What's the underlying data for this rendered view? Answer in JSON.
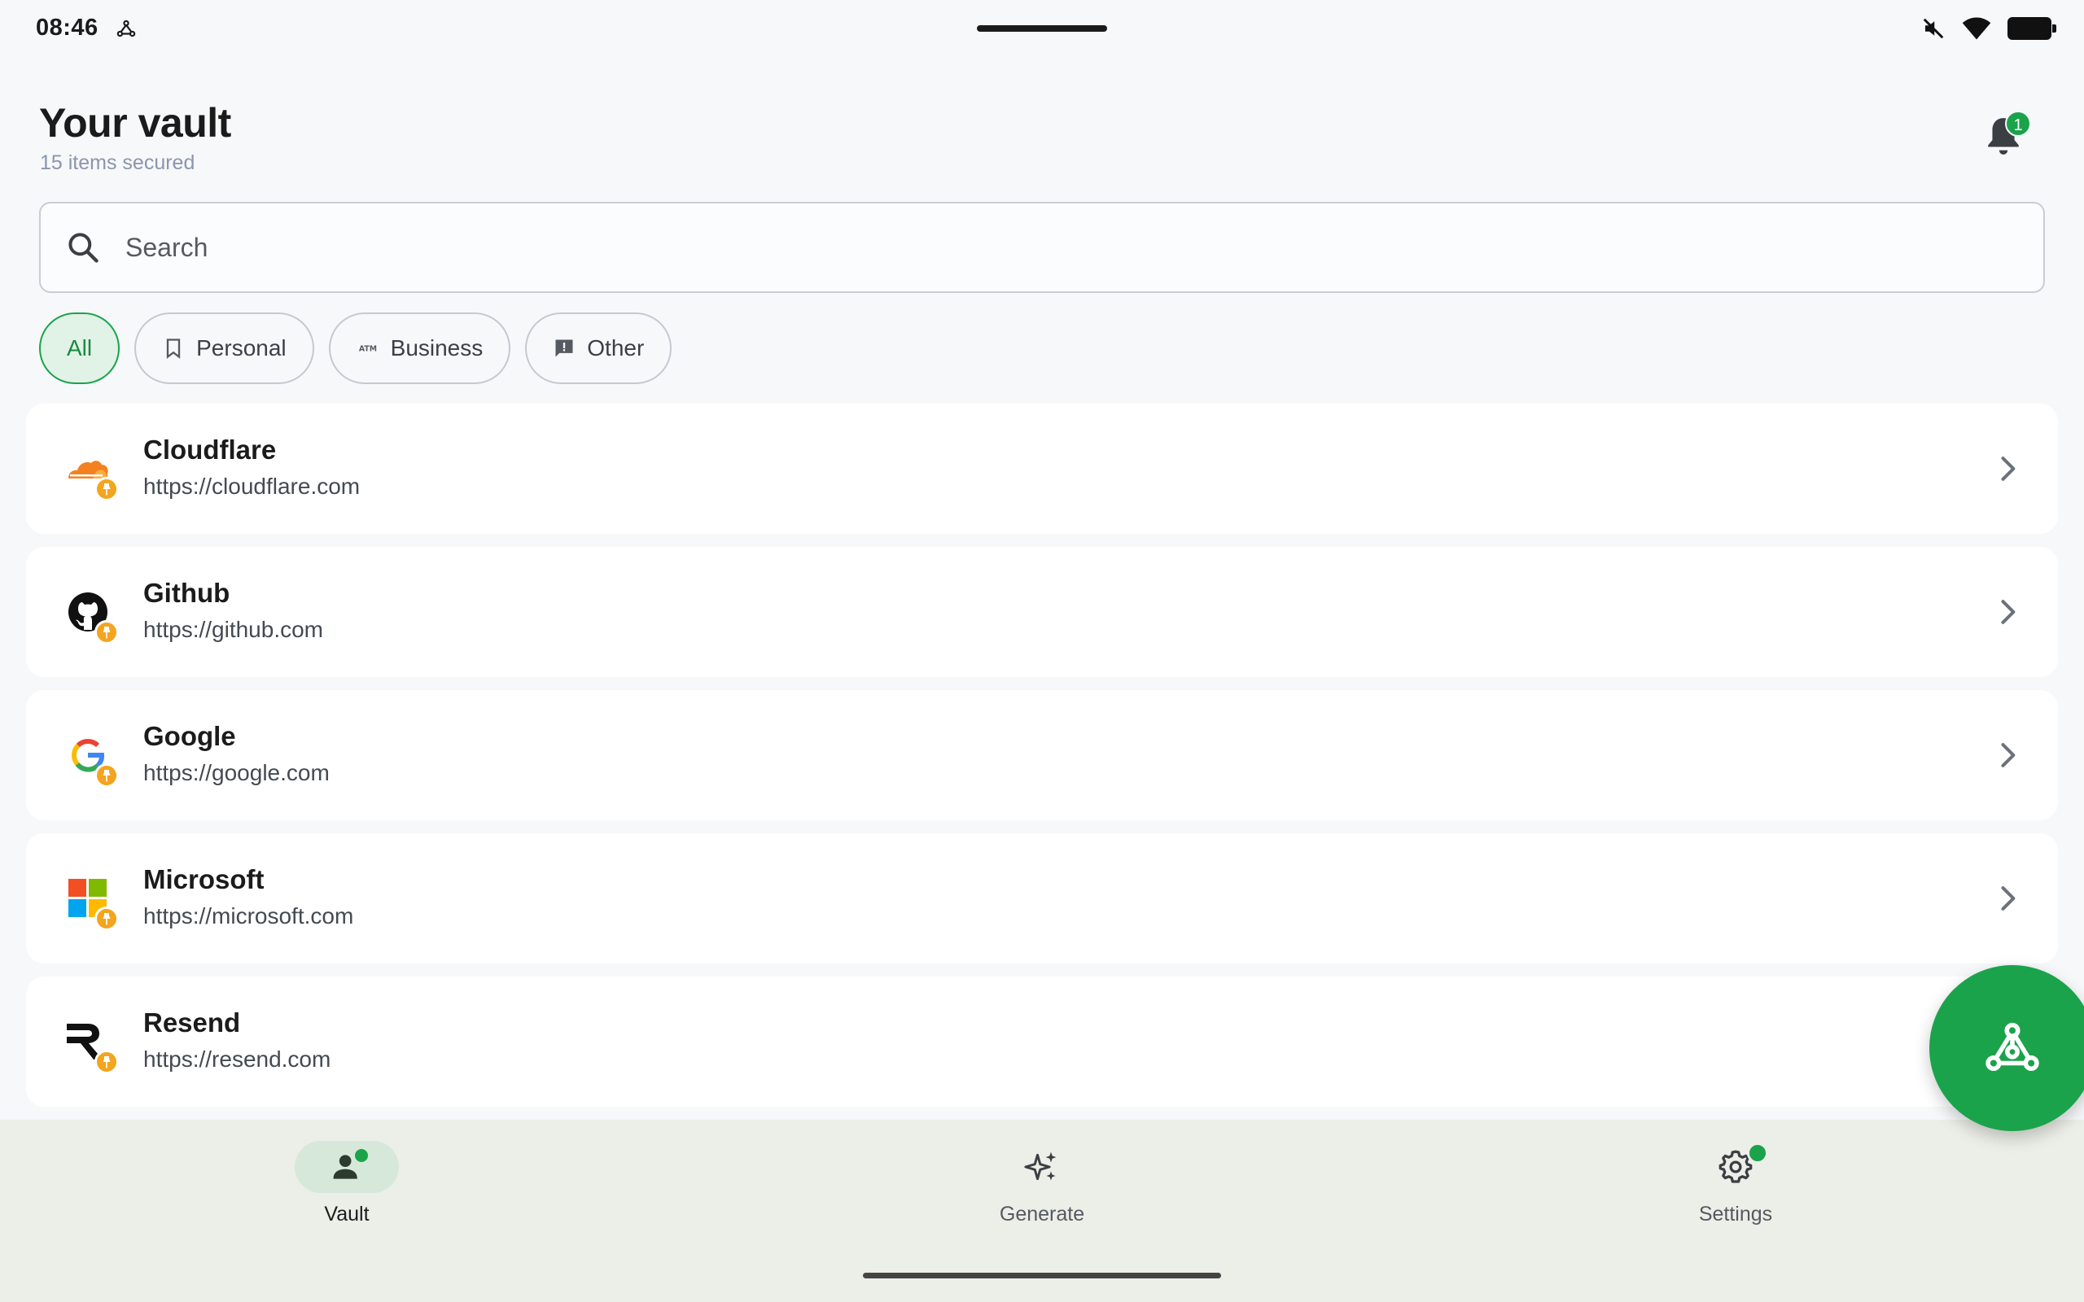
{
  "status_bar": {
    "time": "08:46",
    "icons": [
      "app-notification-icon",
      "mute-icon",
      "wifi-icon",
      "battery-icon"
    ]
  },
  "header": {
    "title": "Your vault",
    "subtitle": "15 items secured",
    "notification_count": "1"
  },
  "search": {
    "placeholder": "Search"
  },
  "filters": [
    {
      "label": "All",
      "active": true,
      "icon": ""
    },
    {
      "label": "Personal",
      "active": false,
      "icon": "bookmark-icon"
    },
    {
      "label": "Business",
      "active": false,
      "icon": "atm-icon"
    },
    {
      "label": "Other",
      "active": false,
      "icon": "feedback-icon"
    }
  ],
  "items": [
    {
      "name": "Cloudflare",
      "url": "https://cloudflare.com",
      "logo": "cloudflare-logo",
      "pinned": true
    },
    {
      "name": "Github",
      "url": "https://github.com",
      "logo": "github-logo",
      "pinned": true
    },
    {
      "name": "Google",
      "url": "https://google.com",
      "logo": "google-logo",
      "pinned": true
    },
    {
      "name": "Microsoft",
      "url": "https://microsoft.com",
      "logo": "microsoft-logo",
      "pinned": true
    },
    {
      "name": "Resend",
      "url": "https://resend.com",
      "logo": "resend-logo",
      "pinned": true
    }
  ],
  "nav": {
    "vault": "Vault",
    "generate": "Generate",
    "settings": "Settings"
  },
  "colors": {
    "accent": "#1aa34a",
    "pin": "#f3a51f",
    "background": "#f7f8fa",
    "nav_background": "#eceee8"
  }
}
